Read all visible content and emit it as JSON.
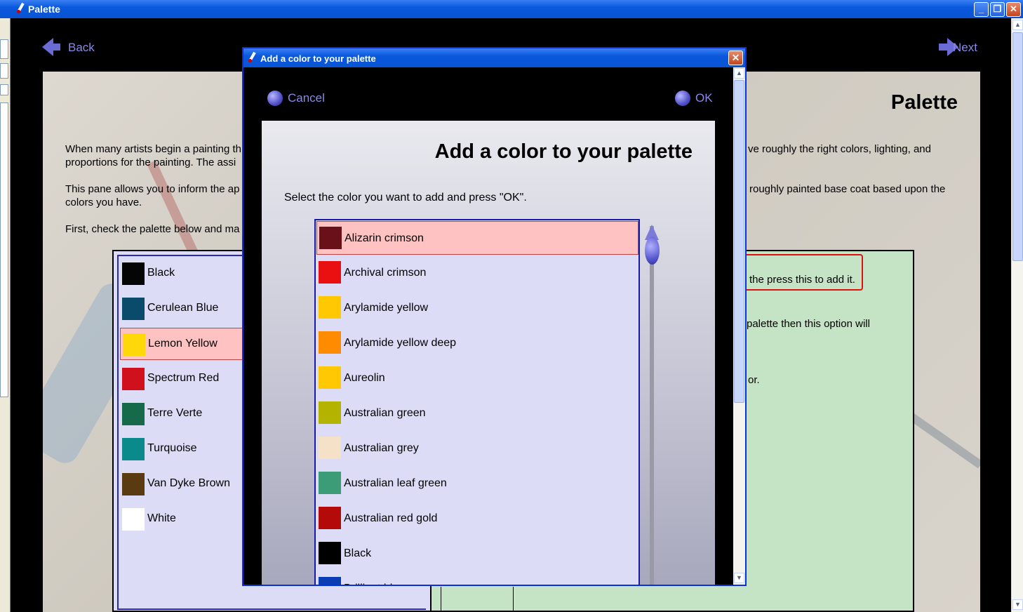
{
  "window": {
    "title": "Palette",
    "min": "_",
    "max": "❐",
    "close": "✕"
  },
  "nav": {
    "back": "Back",
    "next": "Next"
  },
  "page": {
    "title": "Palette",
    "para1_left": "When many artists begin a painting th",
    "para1_left2": "proportions for the painting. The assi",
    "para1_right": "ve roughly the right colors, lighting, and",
    "para2_left": "This pane allows you to inform the ap",
    "para2_left2": "colors you have.",
    "para2_right": "roughly painted base coat based upon the",
    "para3_left": "First, check the palette below and ma"
  },
  "palette": {
    "items": [
      {
        "label": "Black",
        "color": "#050505"
      },
      {
        "label": "Cerulean Blue",
        "color": "#0a4a6a"
      },
      {
        "label": "Lemon Yellow",
        "color": "#ffd80a",
        "selected": true
      },
      {
        "label": "Spectrum Red",
        "color": "#d0101c"
      },
      {
        "label": "Terre Verte",
        "color": "#166a4a"
      },
      {
        "label": "Turquoise",
        "color": "#0a8a8a"
      },
      {
        "label": "Van Dyke Brown",
        "color": "#5a3a10"
      },
      {
        "label": "White",
        "color": "#ffffff"
      }
    ]
  },
  "green": {
    "add_hint": "the press this to add it.",
    "line2": "palette then this option will",
    "line3": "or."
  },
  "dialog": {
    "title": "Add a color to your palette",
    "close": "✕",
    "cancel": "Cancel",
    "ok": "OK",
    "heading": "Add a color to your palette",
    "prompt": "Select the color you want to add and press \"OK\".",
    "colors": [
      {
        "label": "Alizarin crimson",
        "color": "#6a1018",
        "selected": true
      },
      {
        "label": "Archival crimson",
        "color": "#e81010"
      },
      {
        "label": "Arylamide yellow",
        "color": "#ffc800"
      },
      {
        "label": "Arylamide yellow deep",
        "color": "#ff8c00"
      },
      {
        "label": "Aureolin",
        "color": "#ffc800"
      },
      {
        "label": "Australian green",
        "color": "#b4b400"
      },
      {
        "label": "Australian grey",
        "color": "#f5e1c8"
      },
      {
        "label": "Australian leaf green",
        "color": "#3c9c78"
      },
      {
        "label": "Australian red gold",
        "color": "#b40a0a"
      },
      {
        "label": "Black",
        "color": "#000000"
      },
      {
        "label": "Brilliant blue",
        "color": "#0a3cb4"
      }
    ]
  },
  "colors": {
    "accent": "#8a8ae6",
    "titlebar": "#0a58dc"
  }
}
